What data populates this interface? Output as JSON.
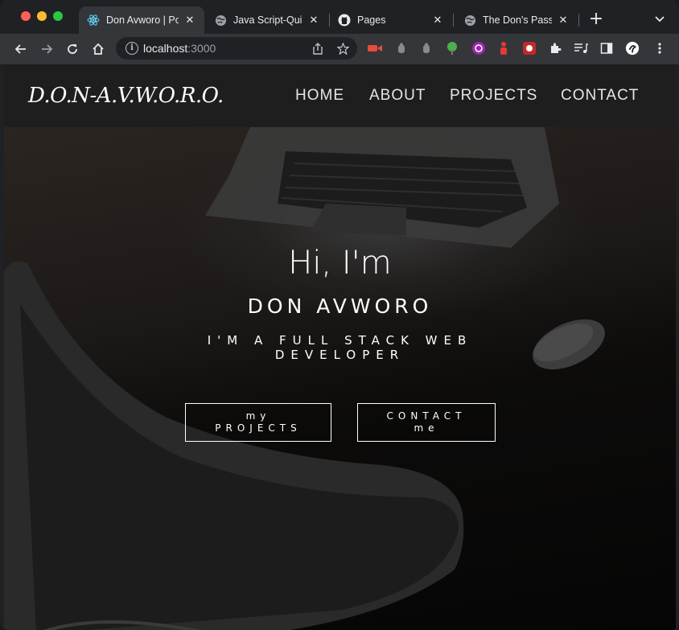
{
  "browser": {
    "tabs": [
      {
        "title": "Don Avworo | Po",
        "icon": "react-icon",
        "active": true
      },
      {
        "title": "Java Script-Qui",
        "icon": "globe-icon",
        "active": false
      },
      {
        "title": "Pages",
        "icon": "github-icon",
        "active": false
      },
      {
        "title": "The Don's Passw",
        "icon": "globe-icon",
        "active": false
      }
    ],
    "close_glyph": "✕",
    "new_tab": "+",
    "tab_menu": "⌄",
    "url_host": "localhost",
    "url_port": ":3000"
  },
  "site": {
    "logo": "D.O.N-A.V.W.O.R.O.",
    "nav": [
      "HOME",
      "ABOUT",
      "PROJECTS",
      "CONTACT"
    ]
  },
  "hero": {
    "greeting": "Hi, I'm",
    "name": "DON AVWORO",
    "role_line1": "I'M A FULL STACK WEB",
    "role_line2": "DEVELOPER",
    "btn_projects_line1": "my",
    "btn_projects_line2": "PROJECTS",
    "btn_contact_line1": "CONTACT",
    "btn_contact_line2": "me"
  },
  "colors": {
    "chrome_bg": "#202124",
    "toolbar_bg": "#35363a",
    "site_nav_bg": "#1e1e1e",
    "text": "#ffffff"
  }
}
